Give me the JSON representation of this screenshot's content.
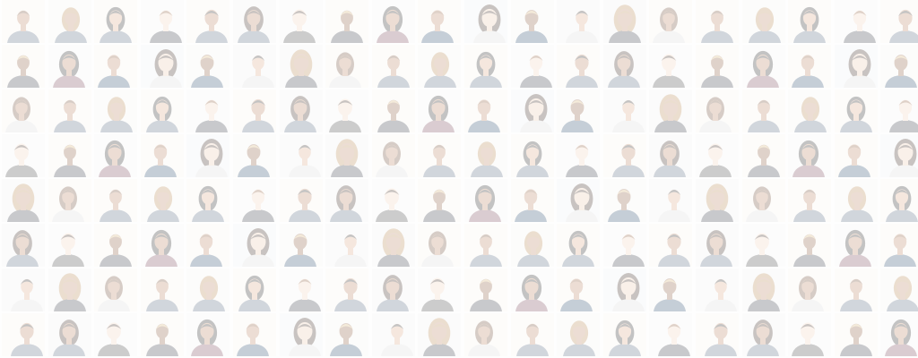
{
  "mosaic": {
    "rows": 8,
    "cols": 20,
    "tile_content": "portrait-icon",
    "palette": {
      "backgrounds": [
        "#f3f3f3",
        "#efefef",
        "#f6f2ee",
        "#eef1f3",
        "#f4f4f0"
      ],
      "skins": [
        "#e8c9b0",
        "#d9a98a",
        "#b98664",
        "#8c5e42",
        "#f0d2bd"
      ],
      "hair": [
        "#6b4a33",
        "#3b2a20",
        "#b88a55",
        "#d8b67a",
        "#2a2a2a",
        "#8a5a3a"
      ],
      "clothes": [
        "#3a3f4a",
        "#5a6b80",
        "#c9c9c9",
        "#2f4f6f",
        "#7a4a5a",
        "#dcdcdc",
        "#4a4a4a"
      ]
    }
  }
}
